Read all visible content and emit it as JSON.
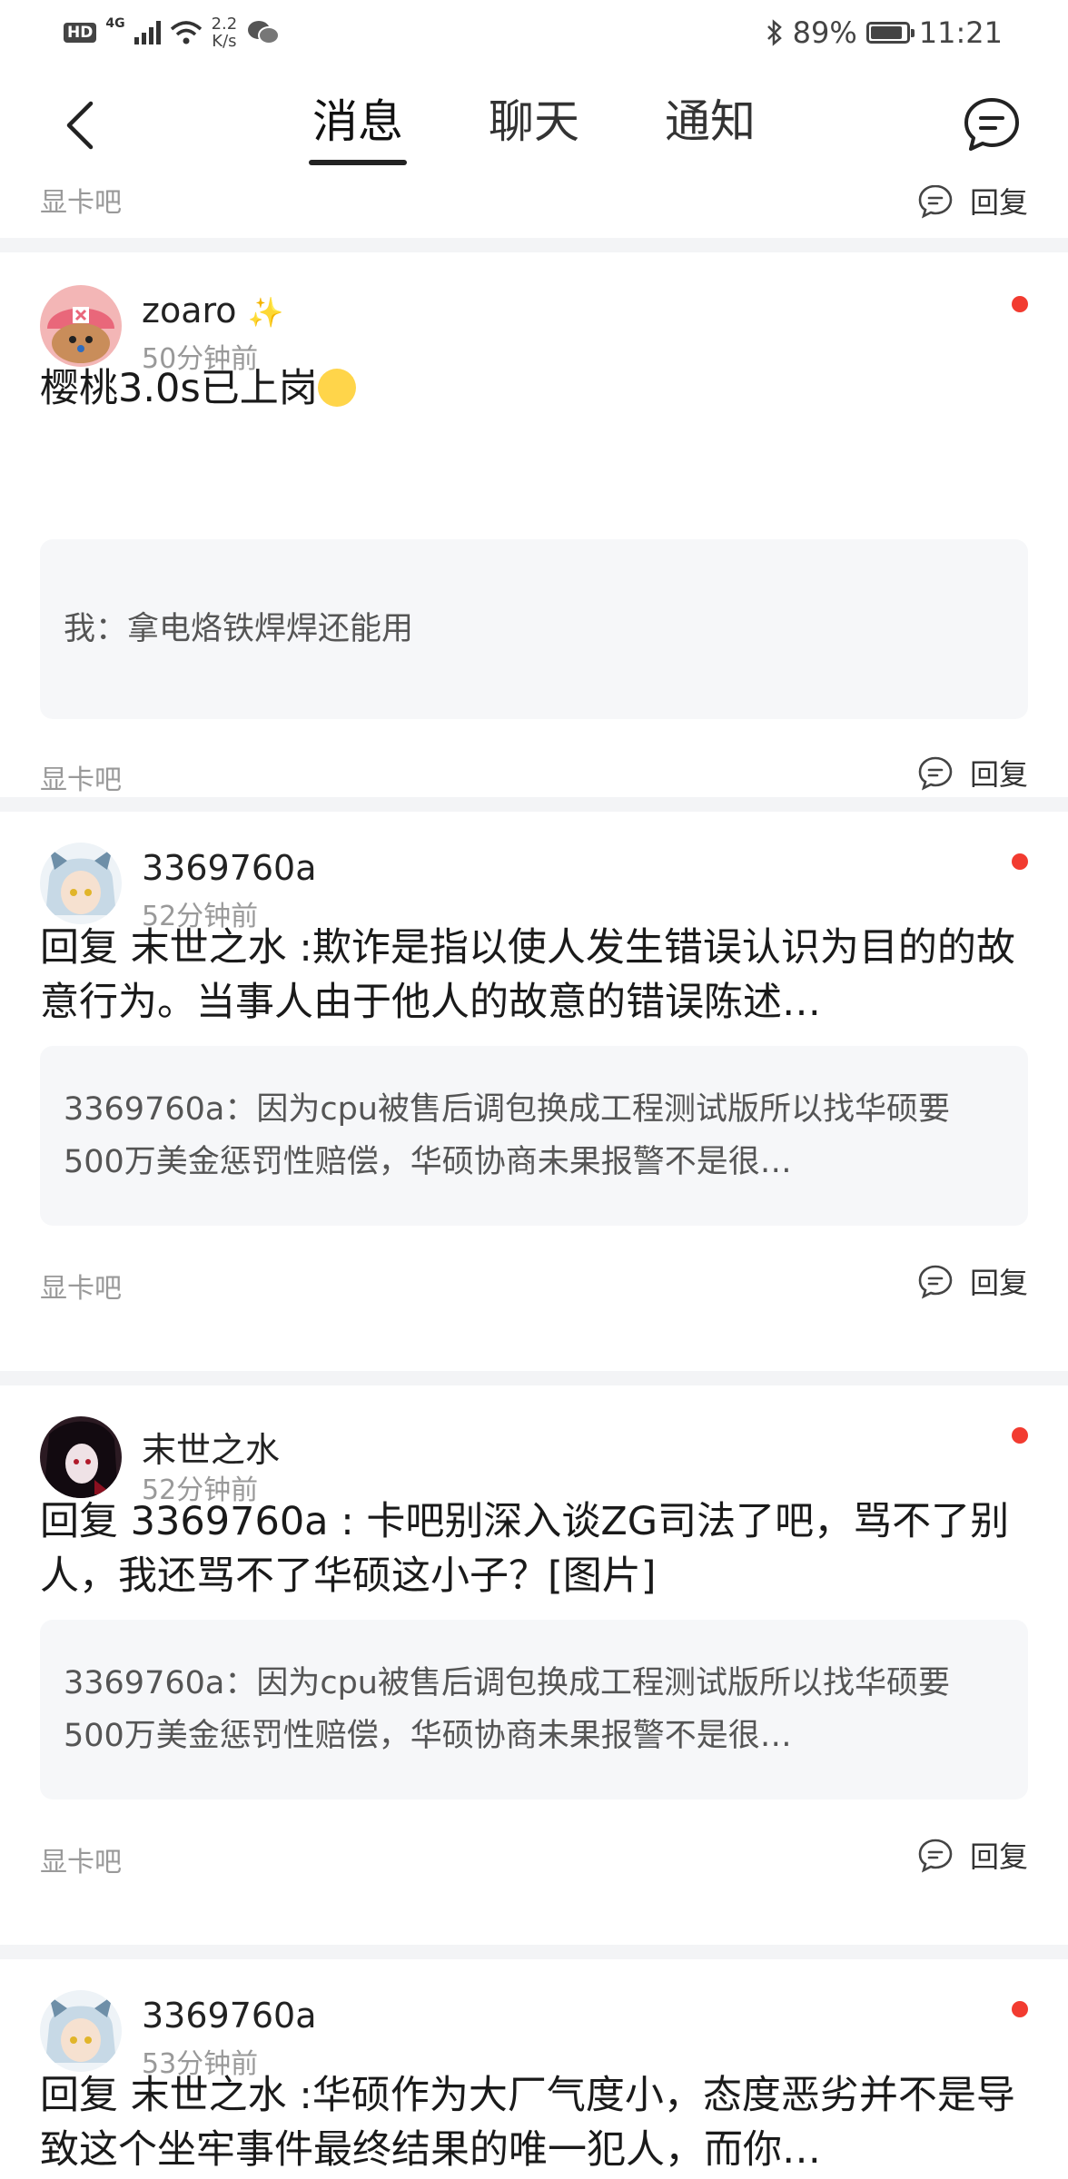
{
  "status_bar": {
    "hd": "HD",
    "network": "4G",
    "speed_value": "2.2",
    "speed_unit": "K/s",
    "battery_percent": "89%",
    "battery_level": 0.89,
    "time": "11:21"
  },
  "nav": {
    "tabs": [
      {
        "label": "消息",
        "active": true
      },
      {
        "label": "聊天",
        "active": false
      },
      {
        "label": "通知",
        "active": false
      }
    ]
  },
  "previous_item": {
    "forum": "显卡吧",
    "reply_label": "回复"
  },
  "items": [
    {
      "username": "zoaro",
      "time": "50分钟前",
      "body": "樱桃3.0s已上岗",
      "quote": "我：拿电烙铁焊焊还能用",
      "forum": "显卡吧",
      "reply_label": "回复"
    },
    {
      "username": "3369760a",
      "time": "52分钟前",
      "body": "回复 末世之水 :欺诈是指以使人发生错误认识为目的的故意行为。当事人由于他人的故意的错误陈述…",
      "quote": "3369760a：因为cpu被售后调包换成工程测试版所以找华硕要500万美金惩罚性赔偿，华硕协商未果报警不是很…",
      "forum": "显卡吧",
      "reply_label": "回复"
    },
    {
      "username": "末世之水",
      "time": "52分钟前",
      "body": "回复 3369760a : 卡吧别深入谈ZG司法了吧，骂不了别人，我还骂不了华硕这小子？[图片]",
      "quote": "3369760a：因为cpu被售后调包换成工程测试版所以找华硕要500万美金惩罚性赔偿，华硕协商未果报警不是很…",
      "forum": "显卡吧",
      "reply_label": "回复"
    },
    {
      "username": "3369760a",
      "time": "53分钟前",
      "body": "回复 末世之水 :华硕作为大厂气度小，态度恶劣并不是导致这个坐牢事件最终结果的唯一犯人，而你…"
    }
  ]
}
